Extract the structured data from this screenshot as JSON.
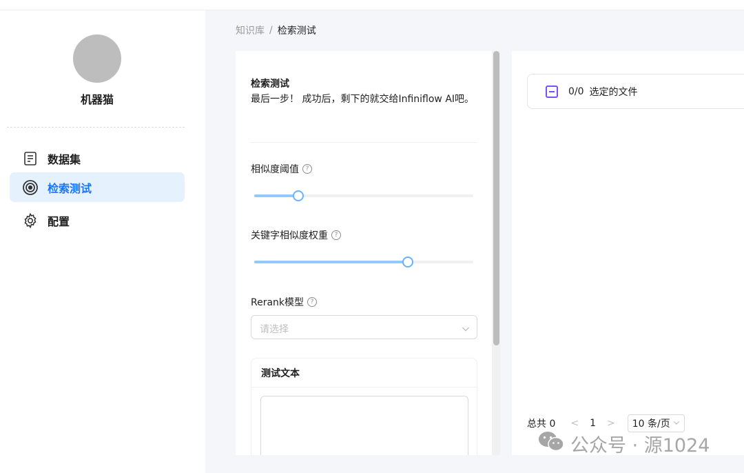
{
  "sidebar": {
    "username": "机器猫",
    "items": [
      {
        "label": "数据集",
        "icon": "dataset-icon"
      },
      {
        "label": "检索测试",
        "icon": "target-icon",
        "active": true
      },
      {
        "label": "配置",
        "icon": "gear-icon"
      }
    ]
  },
  "breadcrumb": {
    "parent": "知识库",
    "separator": "/",
    "current": "检索测试"
  },
  "test_panel": {
    "title": "检索测试",
    "description": "最后一步！ 成功后，剩下的就交给Infiniflow AI吧。",
    "similarity_threshold": {
      "label": "相似度阈值",
      "value": 0.2
    },
    "keyword_weight": {
      "label": "关键字相似度权重",
      "value": 0.7
    },
    "rerank": {
      "label": "Rerank模型",
      "placeholder": "请选择"
    },
    "test_text": {
      "title": "测试文本",
      "value": ""
    }
  },
  "results_panel": {
    "selected_count": "0/0",
    "selected_label": "选定的文件",
    "pagination": {
      "total_label": "总共 0",
      "current_page": "1",
      "page_size": "10 条/页"
    }
  },
  "watermark": {
    "text": "公众号 · 源1024"
  },
  "colors": {
    "accent": "#1677ff",
    "active_bg": "#e6f1fe",
    "slider": "#91caff",
    "checkbox": "#7c4dff"
  }
}
